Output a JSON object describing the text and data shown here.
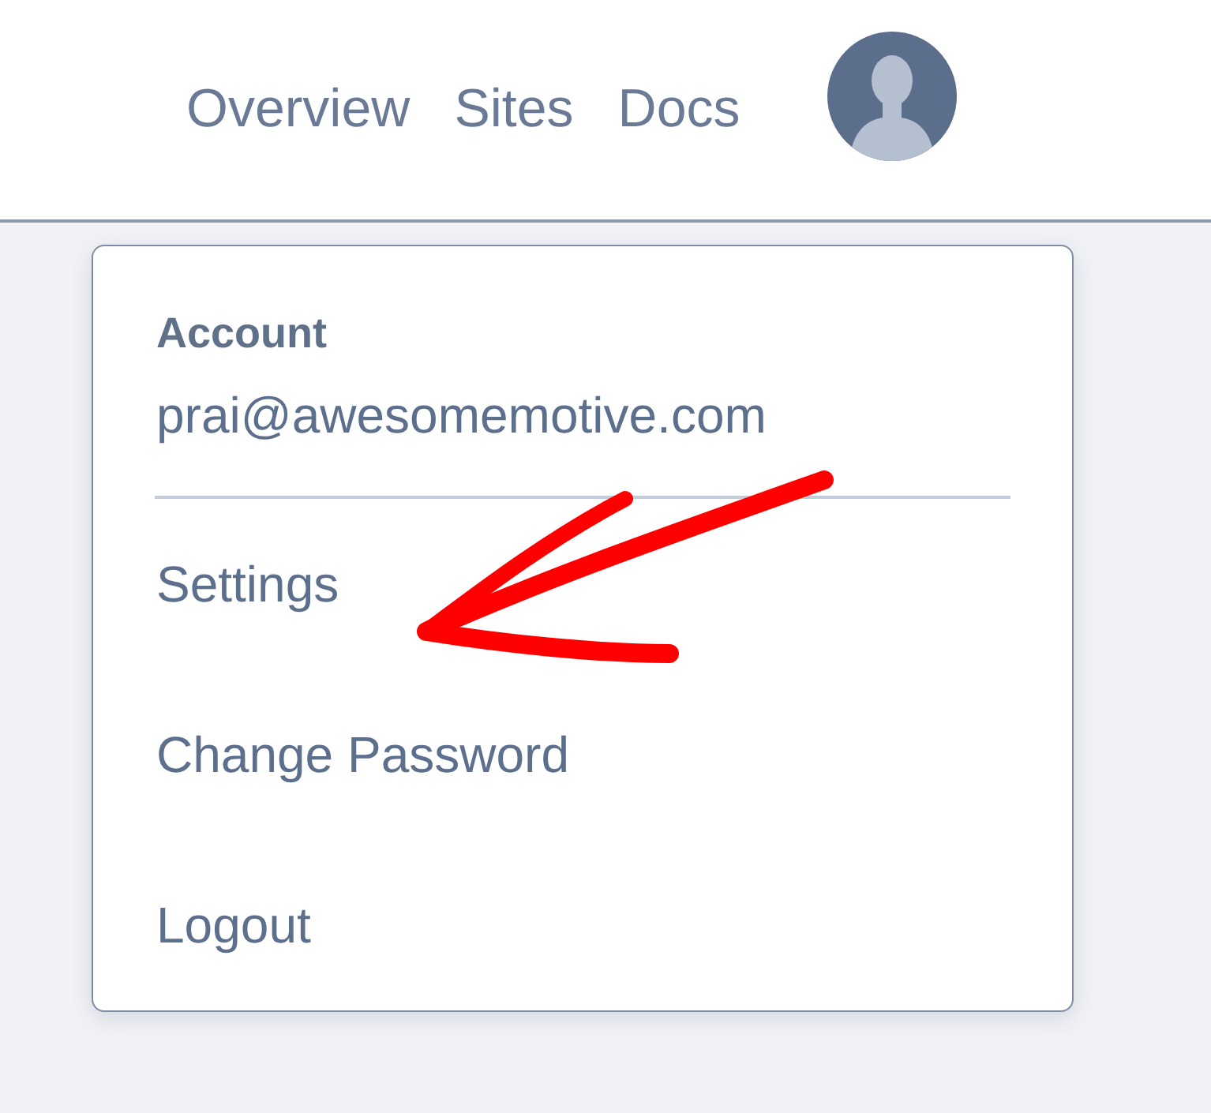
{
  "nav": [
    {
      "label": "Overview"
    },
    {
      "label": "Sites"
    },
    {
      "label": "Docs"
    }
  ],
  "account_menu": {
    "heading": "Account",
    "email": "prai@awesomemotive.com",
    "items": [
      {
        "label": "Settings"
      },
      {
        "label": "Change Password"
      },
      {
        "label": "Logout"
      }
    ]
  }
}
